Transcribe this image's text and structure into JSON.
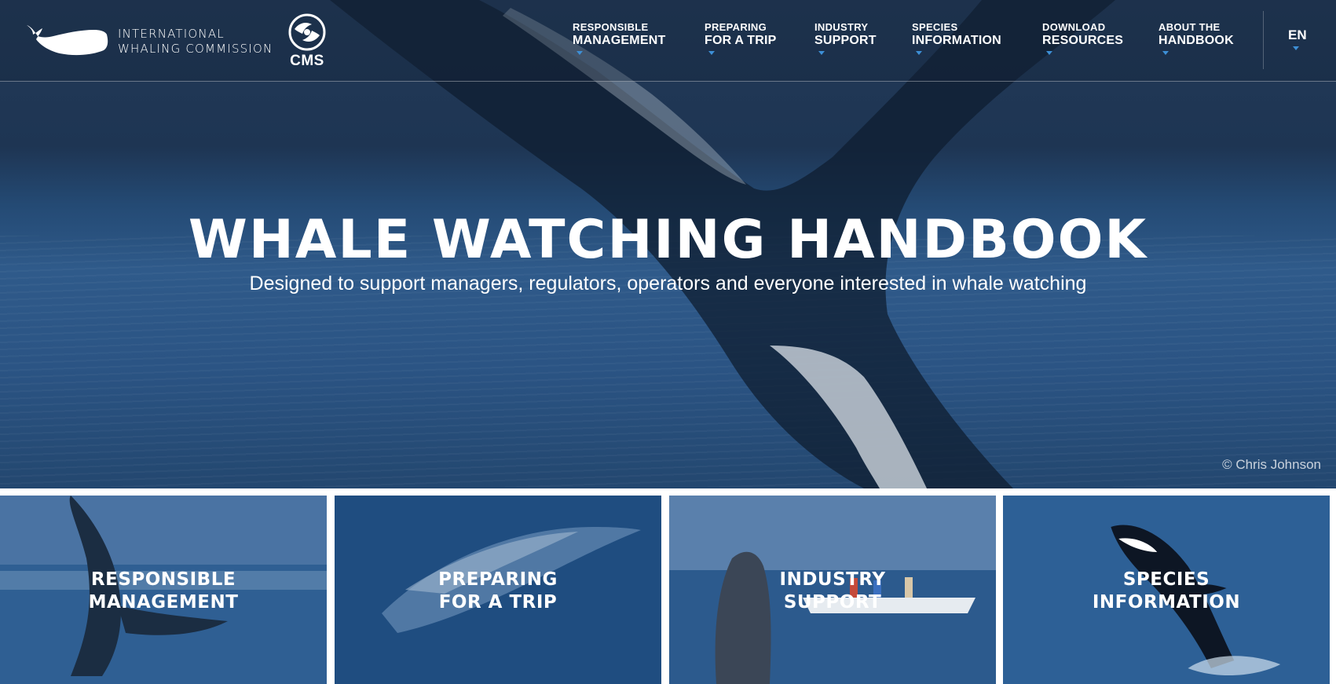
{
  "brand": {
    "org_line1": "INTERNATIONAL",
    "org_line2": "WHALING COMMISSION",
    "partner": "CMS"
  },
  "nav": [
    {
      "line1": "RESPONSIBLE",
      "line2": "MANAGEMENT"
    },
    {
      "line1": "PREPARING",
      "line2": "FOR A TRIP"
    },
    {
      "line1": "INDUSTRY",
      "line2": "SUPPORT"
    },
    {
      "line1": "SPECIES",
      "line2": "INFORMATION"
    },
    {
      "line1": "DOWNLOAD",
      "line2": "RESOURCES"
    },
    {
      "line1": "ABOUT THE",
      "line2": "HANDBOOK"
    }
  ],
  "language": "EN",
  "hero": {
    "title": "WHALE WATCHING HANDBOOK",
    "subtitle": "Designed to support managers, regulators, operators and everyone interested in whale watching",
    "credit": "© Chris Johnson"
  },
  "tiles": [
    {
      "line1": "RESPONSIBLE",
      "line2": "MANAGEMENT"
    },
    {
      "line1": "PREPARING",
      "line2": "FOR A TRIP"
    },
    {
      "line1": "INDUSTRY",
      "line2": "SUPPORT"
    },
    {
      "line1": "SPECIES",
      "line2": "INFORMATION"
    }
  ],
  "colors": {
    "header_overlay": "#142337",
    "hero_blue": "#2b5484",
    "accent_caret": "#3d8fd6"
  }
}
